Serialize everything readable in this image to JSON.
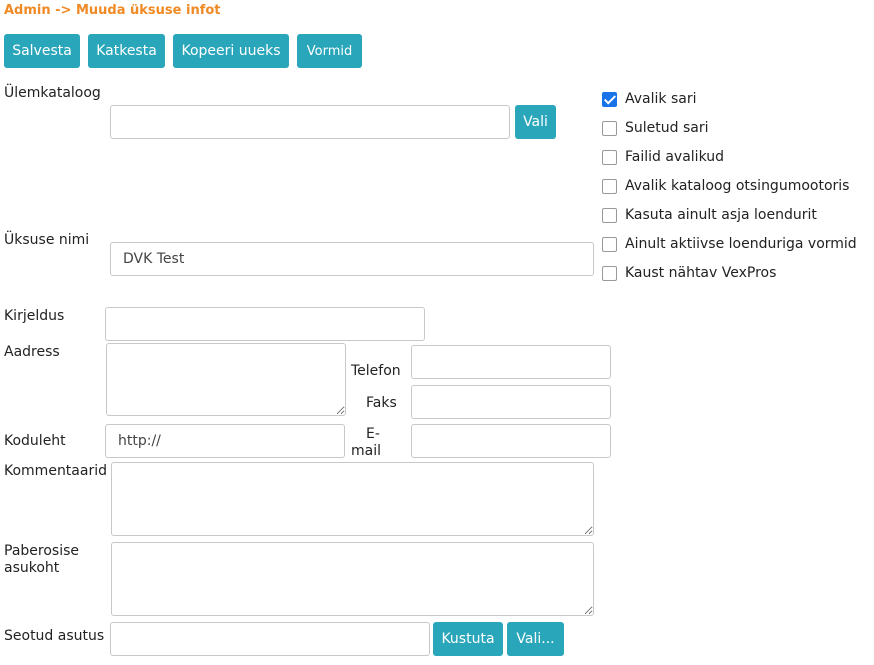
{
  "breadcrumb": "Admin -> Muuda üksuse infot",
  "toolbar": {
    "save_label": "Salvesta",
    "cancel_label": "Katkesta",
    "copy_label": "Kopeeri uueks",
    "forms_label": "Vormid"
  },
  "form": {
    "parent_catalog": {
      "label": "Ülemkataloog",
      "value": "",
      "choose_label": "Vali"
    },
    "unit_name": {
      "label": "Üksuse nimi",
      "value": "DVK Test"
    },
    "description": {
      "label": "Kirjeldus",
      "value": ""
    },
    "address": {
      "label": "Aadress",
      "value": ""
    },
    "phone": {
      "label": "Telefon",
      "value": ""
    },
    "fax": {
      "label": "Faks",
      "value": ""
    },
    "homepage": {
      "label": "Koduleht",
      "value": "http://"
    },
    "email": {
      "label_line1": "E-",
      "label_line2": "mail",
      "value": ""
    },
    "comments": {
      "label": "Kommentaarid",
      "value": ""
    },
    "paper_location": {
      "label_line1": "Paberosise",
      "label_line2": "asukoht",
      "value": ""
    },
    "linked_org": {
      "label": "Seotud asutus",
      "value": "",
      "delete_label": "Kustuta",
      "choose_label": "Vali..."
    }
  },
  "options": [
    {
      "label": "Avalik sari",
      "checked": true
    },
    {
      "label": "Suletud sari",
      "checked": false
    },
    {
      "label": "Failid avalikud",
      "checked": false
    },
    {
      "label": "Avalik kataloog otsingumootoris",
      "checked": false
    },
    {
      "label": "Kasuta ainult asja loendurit",
      "checked": false
    },
    {
      "label": "Ainult aktiivse loenduriga vormid",
      "checked": false
    },
    {
      "label": "Kaust nähtav VexPros",
      "checked": false
    }
  ],
  "colors": {
    "accent": "#2aa6bb",
    "breadcrumb": "#f08a24",
    "checkbox_checked": "#1a73e8"
  }
}
